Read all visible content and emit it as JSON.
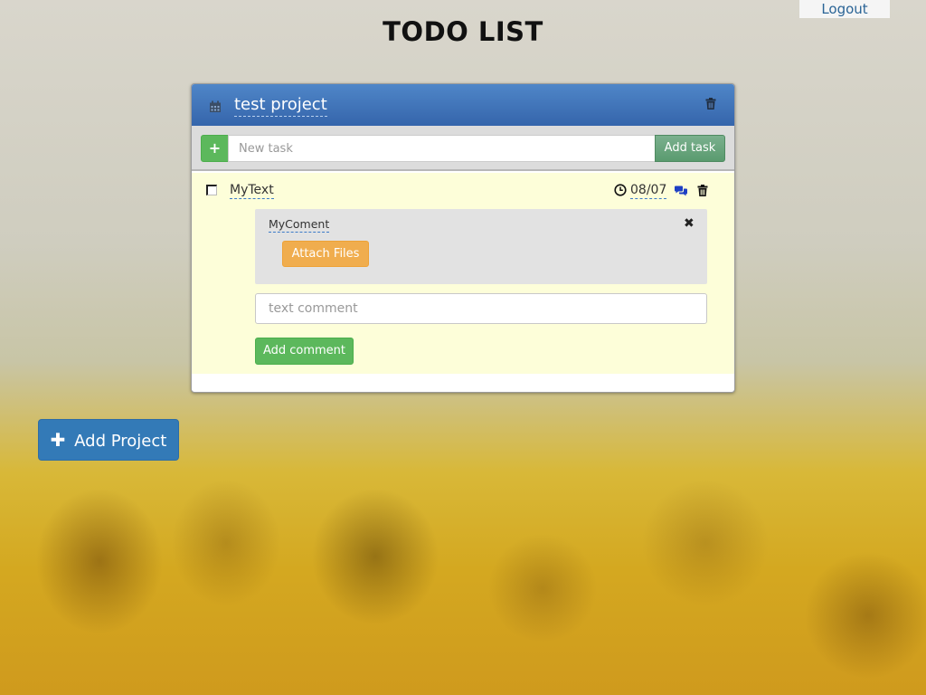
{
  "header": {
    "title": "TODO LIST",
    "logout_label": "Logout"
  },
  "project": {
    "name": "test project",
    "icons": {
      "calendar": "calendar-icon",
      "delete": "trash-icon"
    },
    "new_task": {
      "add_icon": "plus-icon",
      "placeholder": "New task",
      "value": "",
      "button_label": "Add task"
    },
    "tasks": [
      {
        "text": "MyText",
        "done": false,
        "deadline": "08/07",
        "icons": {
          "deadline": "clock-icon",
          "comments": "comments-icon",
          "delete": "trash-icon"
        },
        "comments": [
          {
            "text": "MyComent",
            "attach_label": "Attach Files",
            "close_icon": "close-icon"
          }
        ],
        "comment_input": {
          "placeholder": "text comment",
          "value": ""
        },
        "add_comment_label": "Add comment"
      }
    ]
  },
  "add_project": {
    "label": "Add Project",
    "icon": "plus-icon"
  },
  "colors": {
    "header_blue": "#3a6db5",
    "task_bg": "#fdfed9",
    "success": "#5cb85c",
    "warning": "#f0ad4e",
    "primary": "#337ab7",
    "link": "#2a6496"
  }
}
